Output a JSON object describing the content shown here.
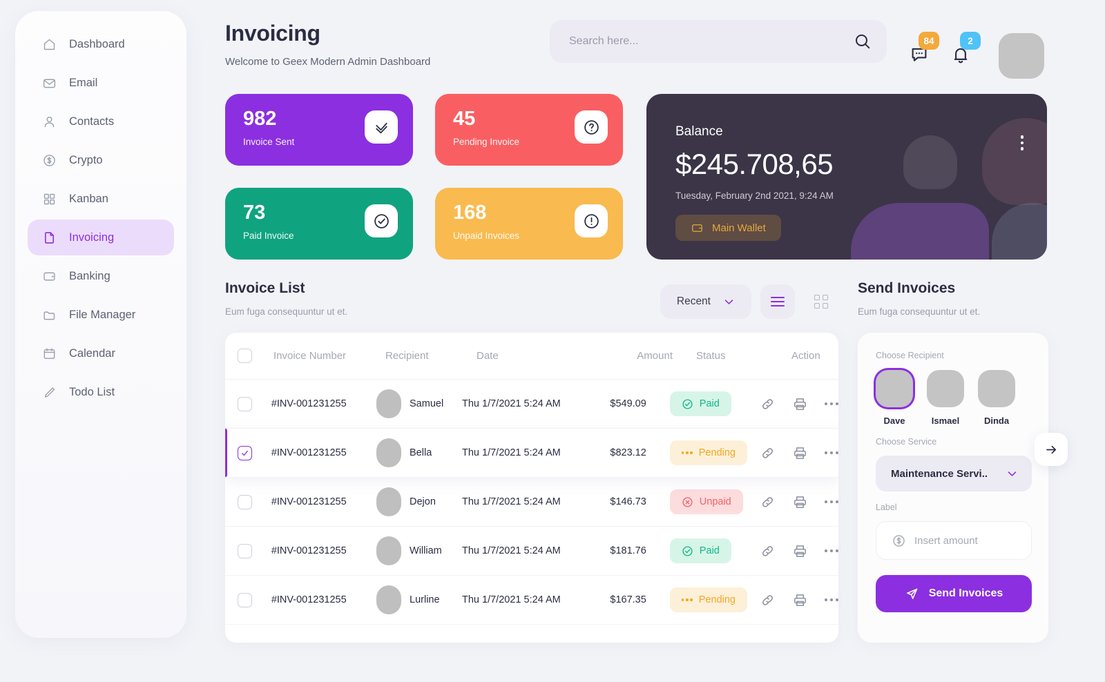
{
  "sidebar": {
    "items": [
      {
        "label": "Dashboard",
        "icon": "home-icon",
        "active": false
      },
      {
        "label": "Email",
        "icon": "envelope-icon",
        "active": false
      },
      {
        "label": "Contacts",
        "icon": "user-icon",
        "active": false
      },
      {
        "label": "Crypto",
        "icon": "dollar-circle-icon",
        "active": false
      },
      {
        "label": "Kanban",
        "icon": "grid-icon",
        "active": false
      },
      {
        "label": "Invoicing",
        "icon": "document-icon",
        "active": true
      },
      {
        "label": "Banking",
        "icon": "wallet-icon",
        "active": false
      },
      {
        "label": "File Manager",
        "icon": "folder-icon",
        "active": false
      },
      {
        "label": "Calendar",
        "icon": "calendar-icon",
        "active": false
      },
      {
        "label": "Todo List",
        "icon": "pencil-icon",
        "active": false
      }
    ]
  },
  "header": {
    "title": "Invoicing",
    "subtitle": "Welcome to Geex Modern Admin Dashboard",
    "search_placeholder": "Search here...",
    "search_value": "",
    "messages_badge": "84",
    "messages_badge_color": "#f4a93c",
    "notifications_badge": "2",
    "notifications_badge_color": "#4fc3f7"
  },
  "stats": [
    {
      "value": "982",
      "label": "Invoice Sent",
      "color": "#8b2fe0",
      "icon": "double-check-icon"
    },
    {
      "value": "45",
      "label": "Pending Invoice",
      "color": "#f95f62",
      "icon": "question-circle-icon"
    },
    {
      "value": "73",
      "label": "Paid Invoice",
      "color": "#10a37f",
      "icon": "check-circle-icon"
    },
    {
      "value": "168",
      "label": "Unpaid Invoices",
      "color": "#f9ba4f",
      "icon": "exclamation-circle-icon"
    }
  ],
  "balance": {
    "label": "Balance",
    "amount": "$245.708,65",
    "date": "Tuesday, February 2nd 2021, 9:24 AM",
    "wallet_label": "Main Wallet",
    "accent": "#e4a93f"
  },
  "invoice_list": {
    "title": "Invoice List",
    "subtitle": "Eum fuga consequuntur ut et.",
    "sort_label": "Recent",
    "columns": [
      "Invoice Number",
      "Recipient",
      "Date",
      "Amount",
      "Status",
      "Action"
    ],
    "rows": [
      {
        "invoice": "#INV-001231255",
        "recipient": "Samuel",
        "date": "Thu 1/7/2021 5:24 AM",
        "amount": "$549.09",
        "status": "Paid",
        "status_type": "paid",
        "checked": false,
        "selected": false
      },
      {
        "invoice": "#INV-001231255",
        "recipient": "Bella",
        "date": "Thu 1/7/2021 5:24 AM",
        "amount": "$823.12",
        "status": "Pending",
        "status_type": "pending",
        "checked": true,
        "selected": true
      },
      {
        "invoice": "#INV-001231255",
        "recipient": "Dejon",
        "date": "Thu 1/7/2021 5:24 AM",
        "amount": "$146.73",
        "status": "Unpaid",
        "status_type": "unpaid",
        "checked": false,
        "selected": false
      },
      {
        "invoice": "#INV-001231255",
        "recipient": "William",
        "date": "Thu 1/7/2021 5:24 AM",
        "amount": "$181.76",
        "status": "Paid",
        "status_type": "paid",
        "checked": false,
        "selected": false
      },
      {
        "invoice": "#INV-001231255",
        "recipient": "Lurline",
        "date": "Thu 1/7/2021 5:24 AM",
        "amount": "$167.35",
        "status": "Pending",
        "status_type": "pending",
        "checked": false,
        "selected": false
      }
    ]
  },
  "send_invoices": {
    "title": "Send Invoices",
    "subtitle": "Eum fuga consequuntur ut et.",
    "choose_recipient_label": "Choose Recipient",
    "recipients": [
      {
        "name": "Dave",
        "selected": true
      },
      {
        "name": "Ismael",
        "selected": false
      },
      {
        "name": "Dinda",
        "selected": false
      }
    ],
    "choose_service_label": "Choose Service",
    "service_value": "Maintenance Servi..",
    "amount_label": "Label",
    "amount_placeholder": "Insert amount",
    "amount_value": "",
    "submit_label": "Send Invoices"
  }
}
